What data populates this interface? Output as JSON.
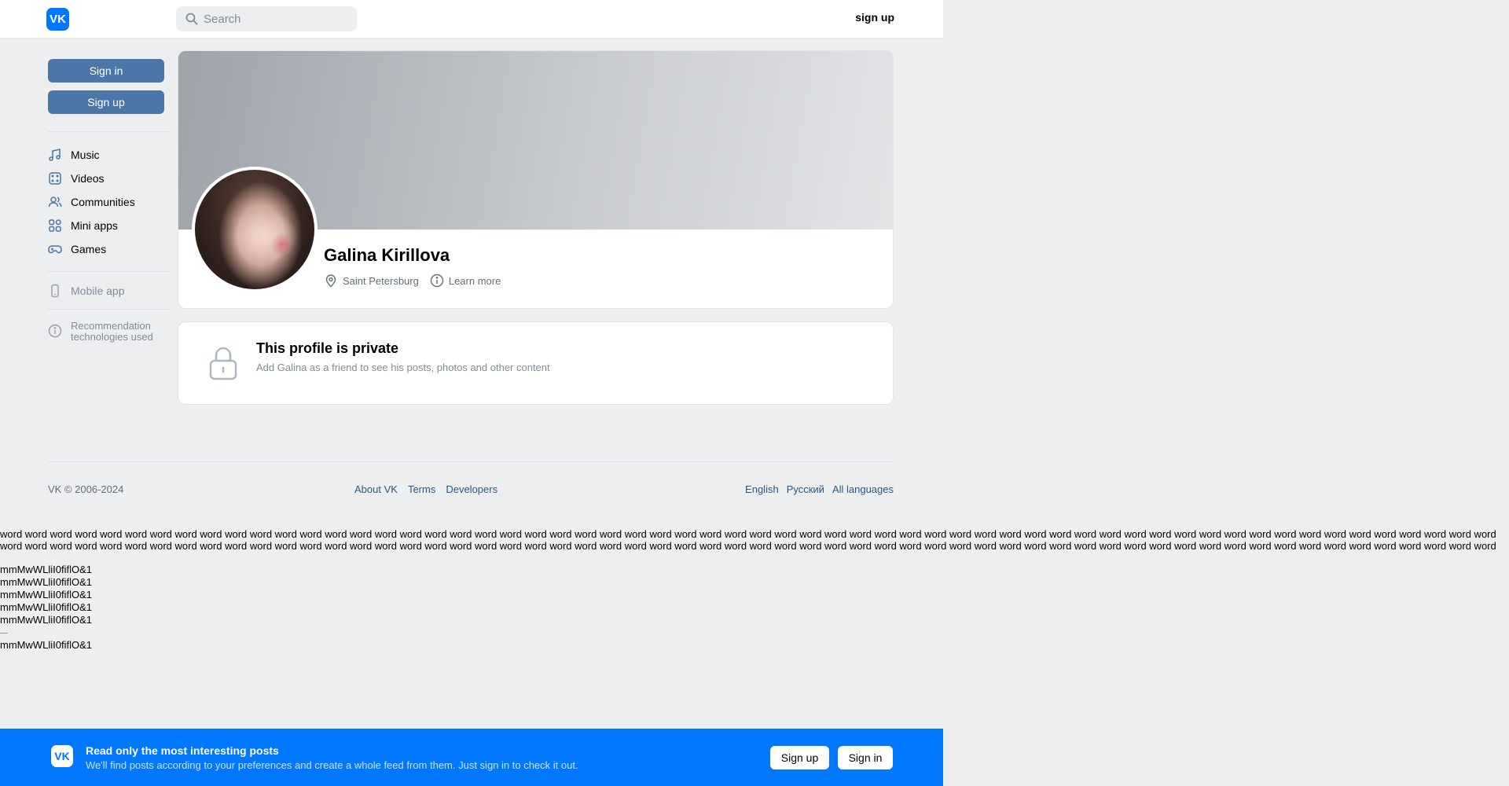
{
  "header": {
    "logo_text": "VK",
    "search_placeholder": "Search",
    "signup_label": "sign up"
  },
  "sidebar": {
    "signin_label": "Sign in",
    "signup_label": "Sign up",
    "items": [
      {
        "label": "Music",
        "icon": "music-icon"
      },
      {
        "label": "Videos",
        "icon": "video-icon"
      },
      {
        "label": "Communities",
        "icon": "users-icon"
      },
      {
        "label": "Mini apps",
        "icon": "apps-icon"
      },
      {
        "label": "Games",
        "icon": "gamepad-icon"
      }
    ],
    "mobile_app_label": "Mobile app",
    "recommendation_line1": "Recommendation",
    "recommendation_line2": "technologies used"
  },
  "profile": {
    "name": "Galina Kirillova",
    "city": "Saint Petersburg",
    "learn_more": "Learn more"
  },
  "private": {
    "title": "This profile is private",
    "subtitle": "Add Galina as a friend to see his posts, photos and other content"
  },
  "footer": {
    "copyright": "VK © 2006-2024",
    "links": [
      "About VK",
      "Terms",
      "Developers"
    ],
    "languages": [
      "English",
      "Русский",
      "All languages"
    ]
  },
  "test_text": {
    "word": "word",
    "glyphs": "mmMwWLliI0fiflO&1"
  },
  "banner": {
    "title": "Read only the most interesting posts",
    "subtitle": "We'll find posts according to your preferences and create a whole feed from them. Just sign in to check it out.",
    "signup_label": "Sign up",
    "signin_label": "Sign in"
  },
  "colors": {
    "accent": "#0077ff",
    "button": "#4a76a8",
    "background": "#edeef0"
  }
}
